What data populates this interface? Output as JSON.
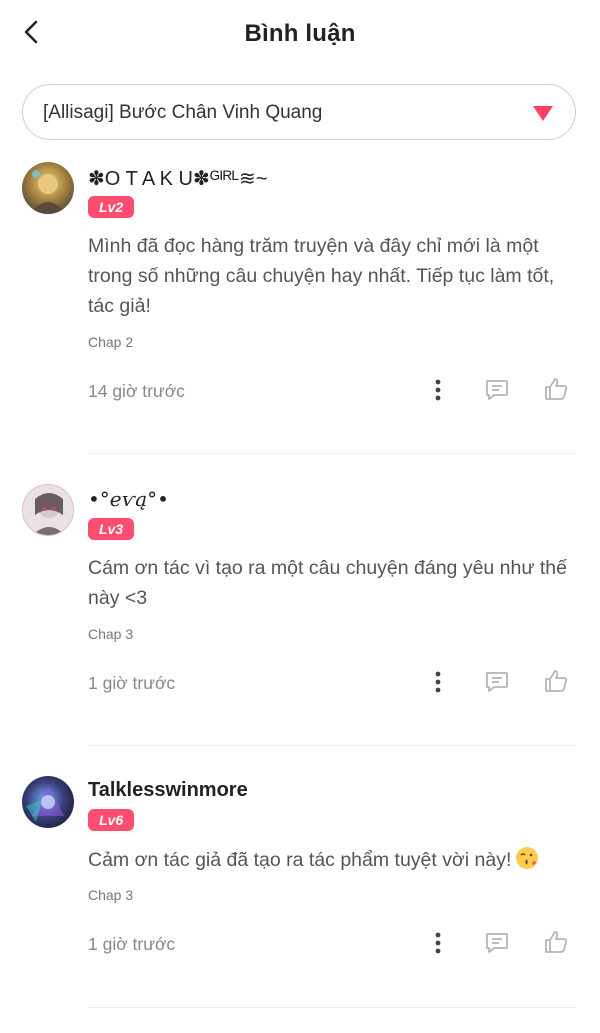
{
  "header": {
    "title": "Bình luận",
    "back_icon": "chevron-left-icon"
  },
  "chapter_selector": {
    "value": "[Allisagi] Bước Chân Vinh Quang",
    "caret_color": "#ff3e6a"
  },
  "colors": {
    "accent": "#ff4d6f",
    "text_primary": "#222222",
    "text_secondary": "#555555",
    "text_muted": "#888888",
    "icon": "#b5b5b5"
  },
  "comments": [
    {
      "username": "✽O T A K U✽ᴳᴵᴿᴸ≋~",
      "level": "Lv2",
      "text": "Mình đã đọc hàng trăm truyện và đây chỉ mới là một trong số những câu chuyện hay nhất. Tiếp tục làm tốt, tác giả!",
      "chap": "Chap 2",
      "time": "14 giờ trước"
    },
    {
      "username": "•°eѵą°•",
      "level": "Lv3",
      "text": "Cám ơn tác vì tạo ra một câu chuyện đáng yêu như thế này <3",
      "chap": "Chap 3",
      "time": "1 giờ trước"
    },
    {
      "username": "Talklesswinmore",
      "level": "Lv6",
      "text": "Cảm ơn tác giả đã tạo ra tác phẩm tuyệt vời này!",
      "emoji": "kissing-face-emoji",
      "chap": "Chap 3",
      "time": "1 giờ trước"
    }
  ],
  "action_icons": [
    "more-vertical-icon",
    "reply-icon",
    "like-icon"
  ]
}
